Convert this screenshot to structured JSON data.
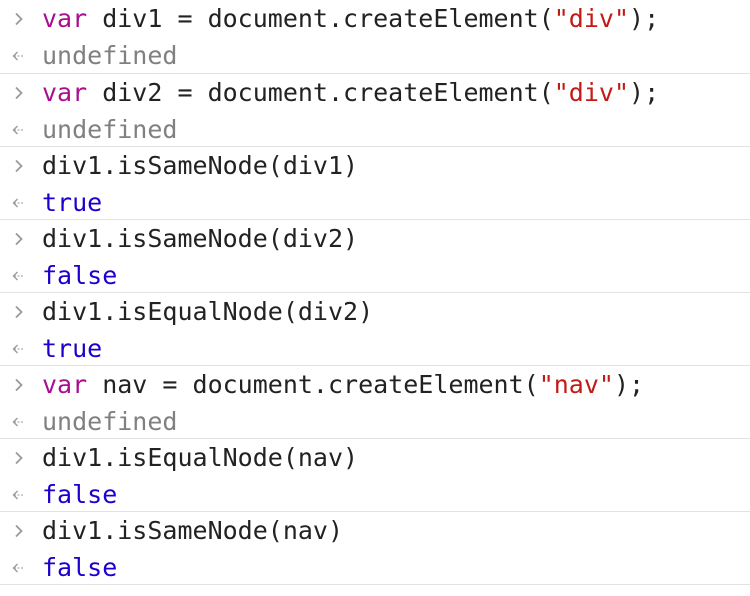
{
  "colors": {
    "keyword": "#aa0d91",
    "plain": "#222222",
    "string": "#c41a16",
    "undefined": "#808080",
    "boolean": "#1c00cf",
    "separator": "#e2e2e2",
    "arrow": "#9a9a9a"
  },
  "icons": {
    "prompt": "chevron-right-icon",
    "result": "return-arrow-icon"
  },
  "entries": [
    {
      "input": [
        {
          "text": "var",
          "kind": "keyword"
        },
        {
          "text": " div1 = document.createElement(",
          "kind": "plain"
        },
        {
          "text": "\"div\"",
          "kind": "string"
        },
        {
          "text": ");",
          "kind": "plain"
        }
      ],
      "output": {
        "text": "undefined",
        "kind": "undefined"
      }
    },
    {
      "input": [
        {
          "text": "var",
          "kind": "keyword"
        },
        {
          "text": " div2 = document.createElement(",
          "kind": "plain"
        },
        {
          "text": "\"div\"",
          "kind": "string"
        },
        {
          "text": ");",
          "kind": "plain"
        }
      ],
      "output": {
        "text": "undefined",
        "kind": "undefined"
      }
    },
    {
      "input": [
        {
          "text": "div1.isSameNode(div1)",
          "kind": "plain"
        }
      ],
      "output": {
        "text": "true",
        "kind": "boolean"
      }
    },
    {
      "input": [
        {
          "text": "div1.isSameNode(div2)",
          "kind": "plain"
        }
      ],
      "output": {
        "text": "false",
        "kind": "boolean"
      }
    },
    {
      "input": [
        {
          "text": "div1.isEqualNode(div2)",
          "kind": "plain"
        }
      ],
      "output": {
        "text": "true",
        "kind": "boolean"
      }
    },
    {
      "input": [
        {
          "text": "var",
          "kind": "keyword"
        },
        {
          "text": " nav = document.createElement(",
          "kind": "plain"
        },
        {
          "text": "\"nav\"",
          "kind": "string"
        },
        {
          "text": ");",
          "kind": "plain"
        }
      ],
      "output": {
        "text": "undefined",
        "kind": "undefined"
      }
    },
    {
      "input": [
        {
          "text": "div1.isEqualNode(nav)",
          "kind": "plain"
        }
      ],
      "output": {
        "text": "false",
        "kind": "boolean"
      }
    },
    {
      "input": [
        {
          "text": "div1.isSameNode(nav)",
          "kind": "plain"
        }
      ],
      "output": {
        "text": "false",
        "kind": "boolean"
      }
    }
  ]
}
